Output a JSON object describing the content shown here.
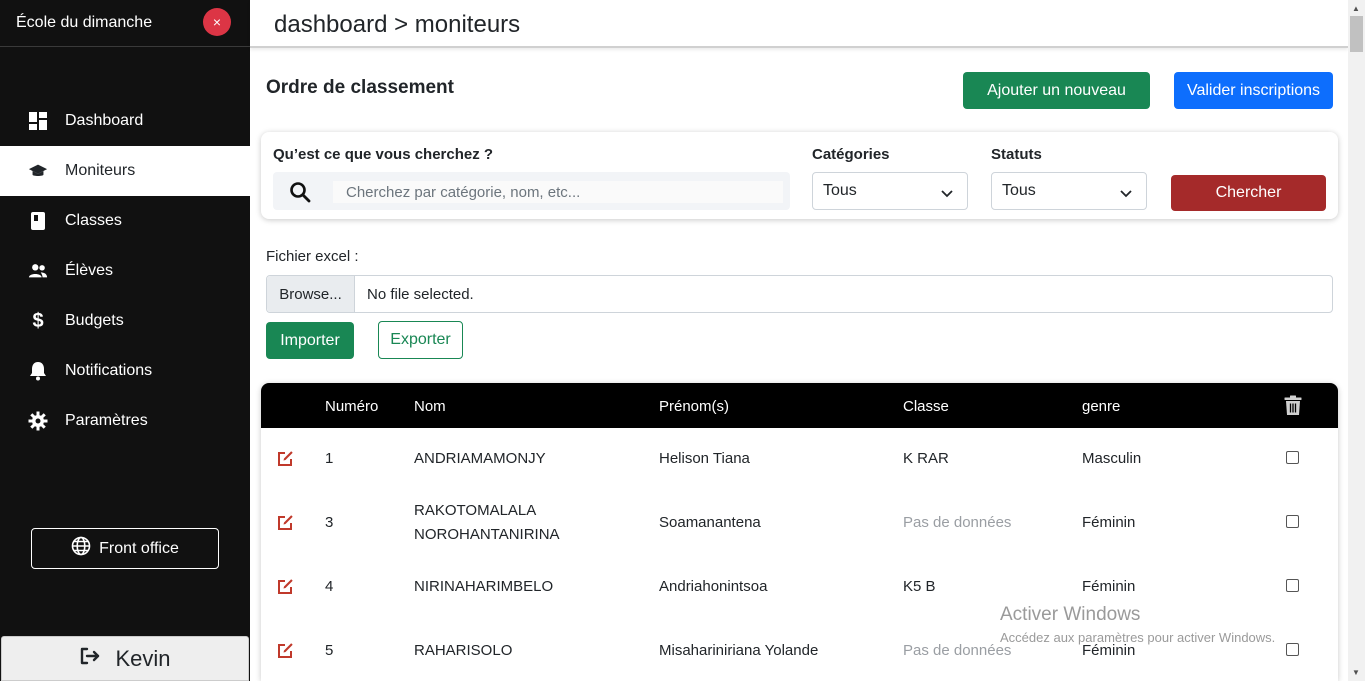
{
  "sidebar": {
    "title": "École du dimanche",
    "close_glyph": "×",
    "items": [
      {
        "label": "Dashboard",
        "icon": "dashboard-icon",
        "active": false
      },
      {
        "label": "Moniteurs",
        "icon": "graduation-cap-icon",
        "active": true
      },
      {
        "label": "Classes",
        "icon": "book-icon",
        "active": false
      },
      {
        "label": "Élèves",
        "icon": "users-icon",
        "active": false
      },
      {
        "label": "Budgets",
        "icon": "dollar-icon",
        "active": false
      },
      {
        "label": "Notifications",
        "icon": "bell-icon",
        "active": false
      },
      {
        "label": "Paramètres",
        "icon": "gear-icon",
        "active": false
      }
    ],
    "front_office_label": "Front office",
    "user_name": "Kevin"
  },
  "header": {
    "breadcrumb": "dashboard > moniteurs"
  },
  "main": {
    "title": "Ordre de classement",
    "add_label": "Ajouter un nouveau",
    "validate_label": "Valider inscriptions",
    "search": {
      "question_label": "Qu’est ce que vous cherchez ?",
      "placeholder": "Cherchez par catégorie, nom, etc...",
      "value": "",
      "categories_label": "Catégories",
      "categories_value": "Tous",
      "status_label": "Statuts",
      "status_value": "Tous",
      "submit_label": "Chercher"
    },
    "file": {
      "label": "Fichier excel :",
      "browse_label": "Browse...",
      "file_name": "No file selected."
    },
    "import_label": "Importer",
    "export_label": "Exporter"
  },
  "table": {
    "headers": {
      "numero": "Numéro",
      "nom": "Nom",
      "prenom": "Prénom(s)",
      "classe": "Classe",
      "genre": "genre"
    },
    "rows": [
      {
        "numero": "1",
        "nom": "ANDRIAMAMONJY",
        "nom2": "",
        "prenom": "Helison Tiana",
        "classe": "K RAR",
        "classe_missing": false,
        "genre": "Masculin"
      },
      {
        "numero": "3",
        "nom": "RAKOTOMALALA",
        "nom2": "NOROHANTANIRINA",
        "prenom": "Soamanantena",
        "classe": "Pas de données",
        "classe_missing": true,
        "genre": "Féminin"
      },
      {
        "numero": "4",
        "nom": "NIRINAHARIMBELO",
        "nom2": "",
        "prenom": "Andriahonintsoa",
        "classe": "K5 B",
        "classe_missing": false,
        "genre": "Féminin"
      },
      {
        "numero": "5",
        "nom": "RAHARISOLO",
        "nom2": "",
        "prenom": "Misahariniriana Yolande",
        "classe": "Pas de données",
        "classe_missing": true,
        "genre": "Féminin"
      }
    ]
  },
  "watermark": {
    "title": "Activer Windows",
    "subtitle": "Accédez aux paramètres pour activer Windows."
  },
  "colors": {
    "sidebar_bg": "#111111",
    "success": "#198754",
    "primary": "#0d6efd",
    "search_button": "#a52a2a",
    "close_button": "#dc3545",
    "edit_icon": "#c0392b"
  }
}
